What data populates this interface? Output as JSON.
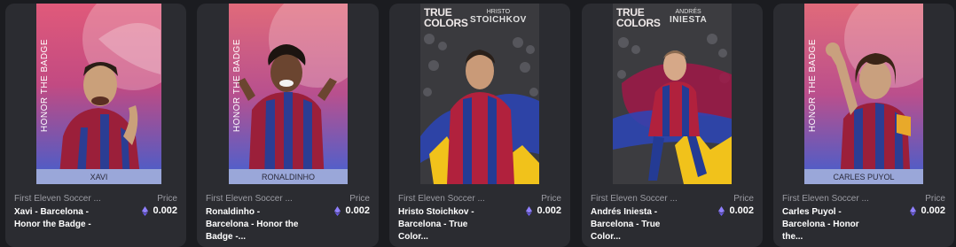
{
  "cards": [
    {
      "collection": "First Eleven Soccer ...",
      "title": "Xavi - Barcelona - Honor the Badge -",
      "price_label": "Price",
      "price": "0.002",
      "art": {
        "side_text": "HONOR THE BADGE",
        "nameplate": "XAVI"
      }
    },
    {
      "collection": "First Eleven Soccer ...",
      "title": "Ronaldinho - Barcelona - Honor the Badge -...",
      "price_label": "Price",
      "price": "0.002",
      "art": {
        "side_text": "HONOR THE BADGE",
        "nameplate": "RONALDINHO"
      }
    },
    {
      "collection": "First Eleven Soccer ...",
      "title": "Hristo Stoichkov - Barcelona - True Color...",
      "price_label": "Price",
      "price": "0.002",
      "art": {
        "title_line1": "TRUE",
        "title_line2": "COLORS",
        "sub_small": "HRISTO",
        "sub_big": "STOICHKOV"
      }
    },
    {
      "collection": "First Eleven Soccer ...",
      "title": "Andrés Iniesta - Barcelona - True Color...",
      "price_label": "Price",
      "price": "0.002",
      "art": {
        "title_line1": "TRUE",
        "title_line2": "COLORS",
        "sub_small": "ANDRÉS",
        "sub_big": "INIESTA"
      }
    },
    {
      "collection": "First Eleven Soccer ...",
      "title": "Carles Puyol - Barcelona - Honor the...",
      "price_label": "Price",
      "price": "0.002",
      "art": {
        "side_text": "HONOR THE BADGE",
        "nameplate": "CARLES PUYOL"
      }
    }
  ],
  "colors": {
    "page_bg": "#1b1c20",
    "card_bg": "#2b2c31",
    "muted_text": "#9b9ca3",
    "eth_purple": "#8f7fff",
    "barca_red": "#b51f3c",
    "barca_blue": "#2a3f9a"
  },
  "icons": {
    "price_currency": "eth-icon"
  }
}
